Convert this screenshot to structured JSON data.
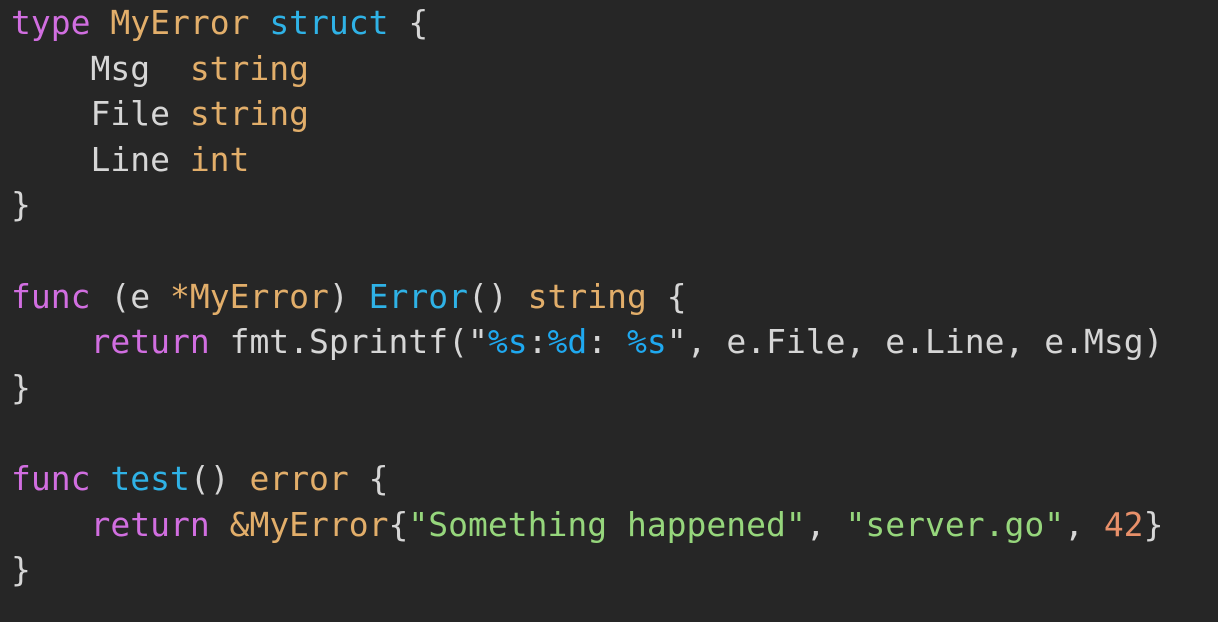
{
  "editor": {
    "language": "go",
    "colors": {
      "background": "#262626",
      "plain": "#d6d6d6",
      "keyword": "#d16ee0",
      "struct_keyword": "#2fb2e6",
      "type": "#e2ae6a",
      "function": "#2fb2e6",
      "string": "#96d67c",
      "format_verb": "#1fa9f0",
      "number": "#e8906a"
    },
    "lines": [
      [
        {
          "t": "type",
          "c": "keyword"
        },
        {
          "t": " ",
          "c": "plain"
        },
        {
          "t": "MyError",
          "c": "typename"
        },
        {
          "t": " ",
          "c": "plain"
        },
        {
          "t": "struct",
          "c": "kw-struct"
        },
        {
          "t": " {",
          "c": "punct"
        }
      ],
      [
        {
          "t": "    Msg  ",
          "c": "plain"
        },
        {
          "t": "string",
          "c": "typename"
        }
      ],
      [
        {
          "t": "    File ",
          "c": "plain"
        },
        {
          "t": "string",
          "c": "typename"
        }
      ],
      [
        {
          "t": "    Line ",
          "c": "plain"
        },
        {
          "t": "int",
          "c": "typename"
        }
      ],
      [
        {
          "t": "}",
          "c": "punct"
        }
      ],
      [],
      [
        {
          "t": "func",
          "c": "keyword"
        },
        {
          "t": " (e ",
          "c": "plain"
        },
        {
          "t": "*MyError",
          "c": "typename"
        },
        {
          "t": ") ",
          "c": "plain"
        },
        {
          "t": "Error",
          "c": "fn"
        },
        {
          "t": "() ",
          "c": "plain"
        },
        {
          "t": "string",
          "c": "typename"
        },
        {
          "t": " {",
          "c": "punct"
        }
      ],
      [
        {
          "t": "    ",
          "c": "plain"
        },
        {
          "t": "return",
          "c": "keyword"
        },
        {
          "t": " fmt.Sprintf(\"",
          "c": "plain"
        },
        {
          "t": "%s",
          "c": "fmt"
        },
        {
          "t": ":",
          "c": "plain"
        },
        {
          "t": "%d",
          "c": "fmt"
        },
        {
          "t": ": ",
          "c": "plain"
        },
        {
          "t": "%s",
          "c": "fmt"
        },
        {
          "t": "\", e.File, e.Line, e.Msg)",
          "c": "plain"
        }
      ],
      [
        {
          "t": "}",
          "c": "punct"
        }
      ],
      [],
      [
        {
          "t": "func",
          "c": "keyword"
        },
        {
          "t": " ",
          "c": "plain"
        },
        {
          "t": "test",
          "c": "fn"
        },
        {
          "t": "() ",
          "c": "plain"
        },
        {
          "t": "error",
          "c": "typename"
        },
        {
          "t": " {",
          "c": "punct"
        }
      ],
      [
        {
          "t": "    ",
          "c": "plain"
        },
        {
          "t": "return",
          "c": "keyword"
        },
        {
          "t": " ",
          "c": "plain"
        },
        {
          "t": "&MyError",
          "c": "typename"
        },
        {
          "t": "{",
          "c": "plain"
        },
        {
          "t": "\"Something happened\"",
          "c": "str"
        },
        {
          "t": ", ",
          "c": "plain"
        },
        {
          "t": "\"server.go\"",
          "c": "str"
        },
        {
          "t": ", ",
          "c": "plain"
        },
        {
          "t": "42",
          "c": "num"
        },
        {
          "t": "}",
          "c": "plain"
        }
      ],
      [
        {
          "t": "}",
          "c": "punct"
        }
      ]
    ]
  }
}
